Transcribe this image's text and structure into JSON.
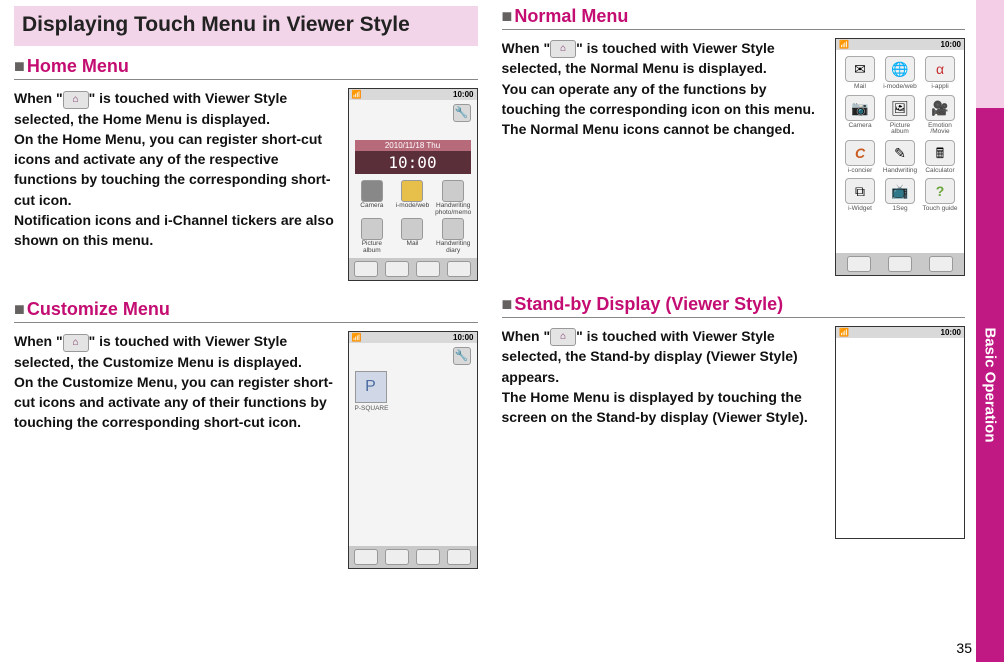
{
  "title": "Displaying Touch Menu in Viewer Style",
  "side_tab": "Basic Operation",
  "page_number": "35",
  "icon_glyph": "⌂",
  "sections": {
    "home": {
      "heading": "Home Menu",
      "text_before": "When \"",
      "text_after": "\" is touched with Viewer Style selected, the Home Menu is displayed.\nOn the Home Menu, you can register short-cut icons and activate any of the respective functions by touching the corresponding short-cut icon.\nNotification icons and i-Channel tickers are also shown on this menu.",
      "thumb": {
        "status_left": "📶",
        "status_right": "10:00",
        "date": "2010/11/18 Thu",
        "time": "10:00",
        "row1": [
          "Camera",
          "i-mode/web",
          "Handwriting photo/memo"
        ],
        "row2": [
          "Picture album",
          "Mail",
          "Handwriting diary"
        ]
      }
    },
    "customize": {
      "heading": "Customize Menu",
      "text_before": "When \"",
      "text_after": "\" is touched with Viewer Style selected, the Customize  Menu is displayed.\nOn the Customize Menu, you can register short-cut icons and activate any of their functions by touching the corresponding short-cut icon.",
      "thumb": {
        "status_left": "📶",
        "status_right": "10:00",
        "item": "P-SQUARE"
      }
    },
    "normal": {
      "heading": "Normal Menu",
      "text_before": "When \"",
      "text_after": "\" is touched with Viewer Style selected, the Normal Menu is displayed.\nYou can operate any of the functions by touching the corresponding icon on this menu. The Normal Menu icons cannot be changed.",
      "thumb": {
        "status_left": "📶",
        "status_right": "10:00",
        "cells": [
          {
            "g": "✉",
            "l": "Mail"
          },
          {
            "g": "🌐",
            "l": "i-mode/web"
          },
          {
            "g": "α",
            "l": "i-appli"
          },
          {
            "g": "📷",
            "l": "Camera"
          },
          {
            "g": "🖼",
            "l": "Picture album"
          },
          {
            "g": "🎥",
            "l": "Emotion /Movie"
          },
          {
            "g": "C",
            "l": "i-concier"
          },
          {
            "g": "✎",
            "l": "Handwriting"
          },
          {
            "g": "🖩",
            "l": "Calculator"
          },
          {
            "g": "⧉",
            "l": "i-Widget"
          },
          {
            "g": "📺",
            "l": "1Seg"
          },
          {
            "g": "?",
            "l": "Touch guide"
          }
        ]
      }
    },
    "standby": {
      "heading": "Stand-by Display (Viewer Style)",
      "text_before": "When \"",
      "text_after": "\" is touched with Viewer Style selected, the Stand-by display (Viewer Style) appears.\nThe Home Menu is displayed by touching the screen on the Stand-by display (Viewer Style).",
      "thumb": {
        "status_left": "📶",
        "status_right": "10:00"
      }
    }
  }
}
